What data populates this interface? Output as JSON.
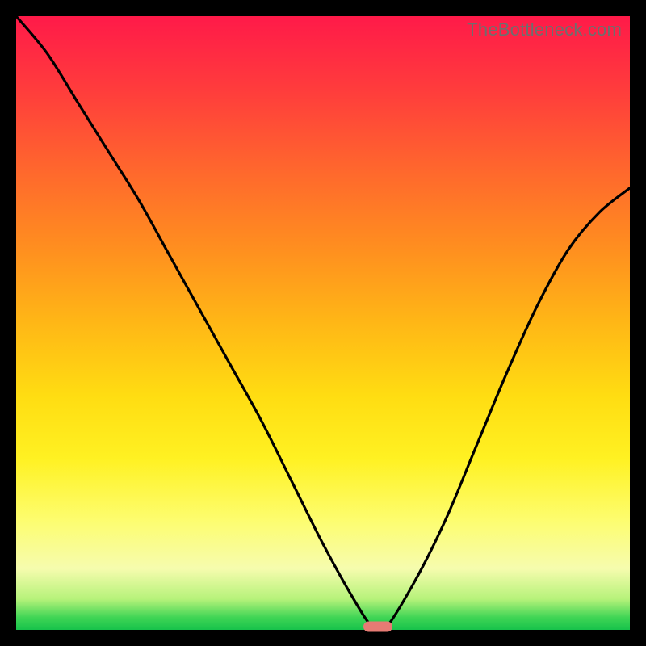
{
  "watermark": "TheBottleneck.com",
  "colors": {
    "page_bg": "#000000",
    "marker": "#e77b74",
    "curve": "#000000",
    "watermark": "#6e6e6e"
  },
  "chart_data": {
    "type": "line",
    "title": "",
    "xlabel": "",
    "ylabel": "",
    "xlim": [
      0,
      100
    ],
    "ylim": [
      0,
      100
    ],
    "grid": false,
    "legend": false,
    "series": [
      {
        "name": "bottleneck-curve",
        "x": [
          0,
          5,
          10,
          15,
          20,
          25,
          30,
          35,
          40,
          45,
          50,
          55,
          58,
          60,
          65,
          70,
          75,
          80,
          85,
          90,
          95,
          100
        ],
        "values": [
          100,
          94,
          86,
          78,
          70,
          61,
          52,
          43,
          34,
          24,
          14,
          5,
          0.5,
          0,
          8,
          18,
          30,
          42,
          53,
          62,
          68,
          72
        ]
      }
    ],
    "marker": {
      "x": 59,
      "y": 0.5
    }
  }
}
